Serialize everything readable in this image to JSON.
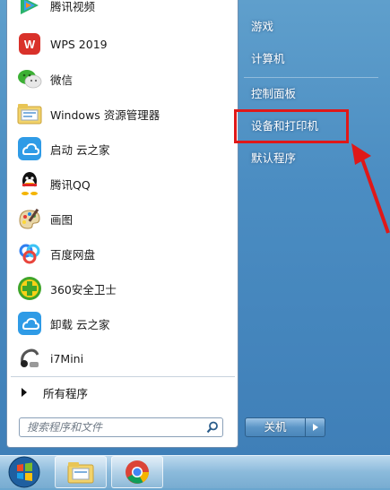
{
  "start_menu": {
    "programs": [
      {
        "label": "腾讯视频",
        "icon": "tencent-video-icon"
      },
      {
        "label": "WPS 2019",
        "icon": "wps-icon"
      },
      {
        "label": "微信",
        "icon": "wechat-icon"
      },
      {
        "label": "Windows 资源管理器",
        "icon": "windows-explorer-icon"
      },
      {
        "label": "启动 云之家",
        "icon": "yunzhijia-icon"
      },
      {
        "label": "腾讯QQ",
        "icon": "qq-icon"
      },
      {
        "label": "画图",
        "icon": "paint-icon"
      },
      {
        "label": "百度网盘",
        "icon": "baidu-netdisk-icon"
      },
      {
        "label": "360安全卫士",
        "icon": "360-security-icon"
      },
      {
        "label": "卸载 云之家",
        "icon": "yunzhijia-icon"
      },
      {
        "label": "i7Mini",
        "icon": "i7mini-icon"
      }
    ],
    "all_programs": "所有程序",
    "search": {
      "placeholder": "搜索程序和文件"
    },
    "right_links": [
      "游戏",
      "计算机",
      "控制面板",
      "设备和打印机",
      "默认程序"
    ],
    "highlighted": "设备和打印机",
    "shutdown_label": "关机"
  },
  "taskbar": {
    "items": [
      "start-orb-icon",
      "windows-explorer-icon",
      "chrome-icon"
    ]
  },
  "colors": {
    "highlight": "#e01818",
    "frame": "#4b8dc2"
  }
}
